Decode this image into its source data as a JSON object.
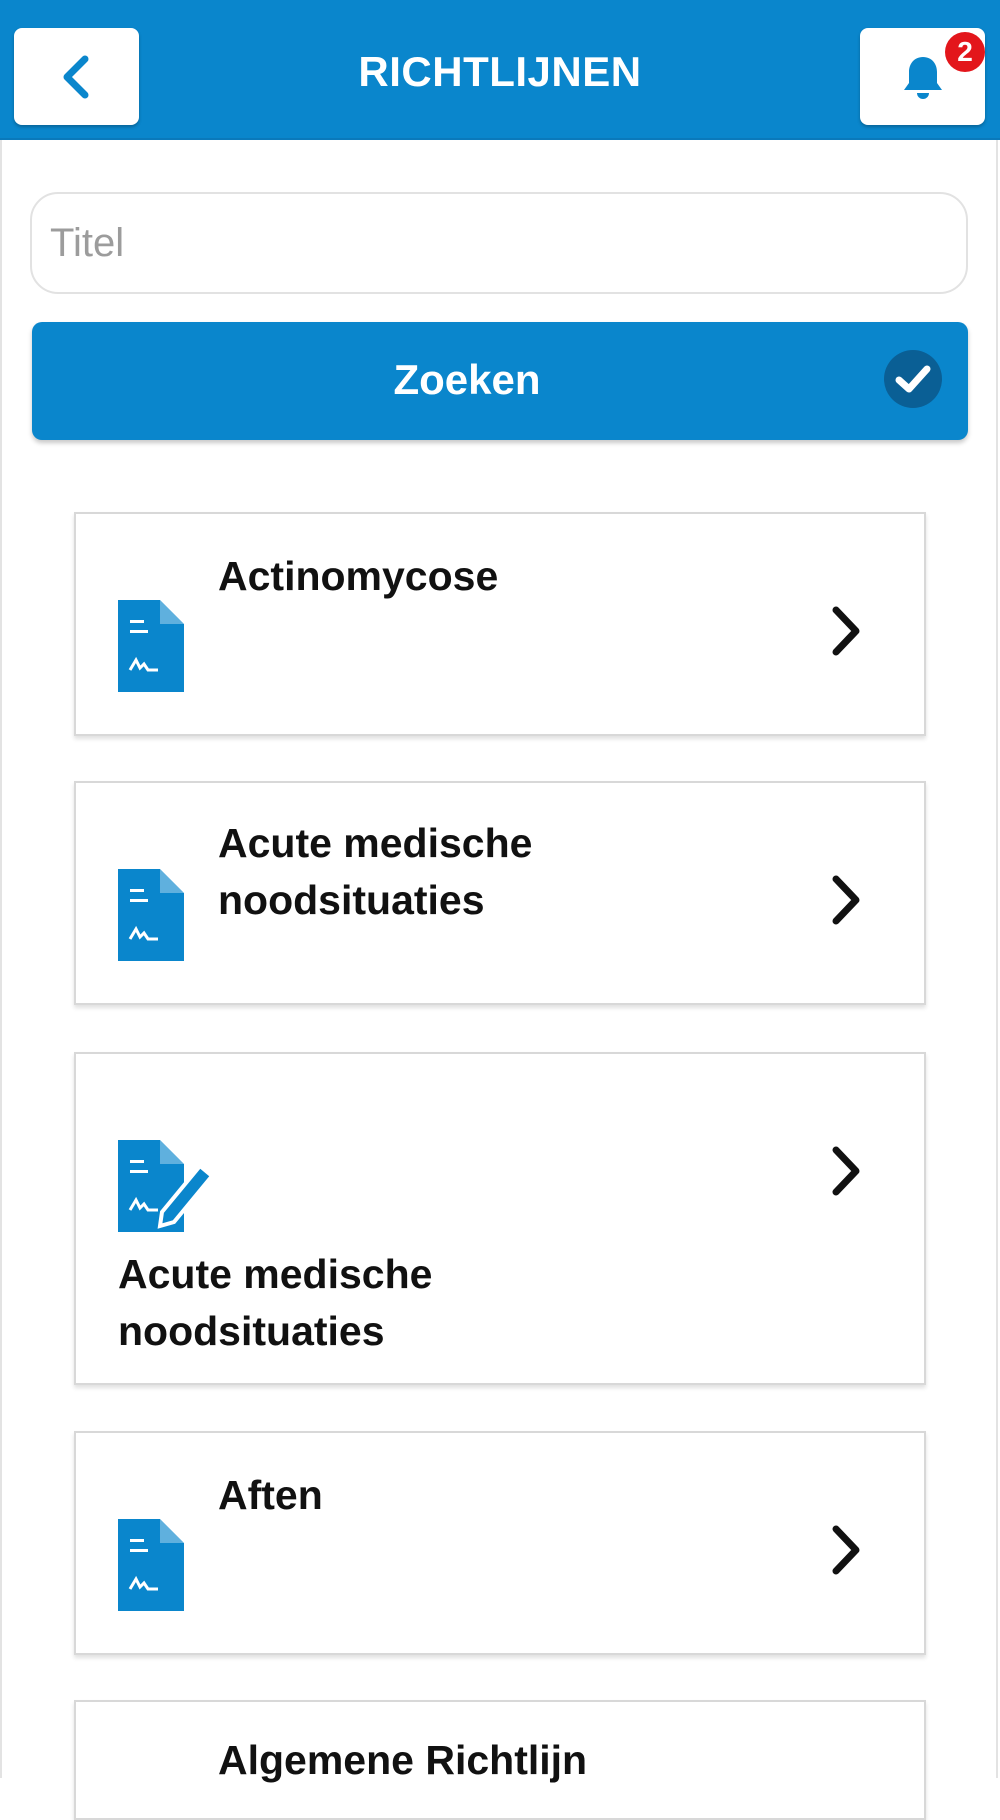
{
  "header": {
    "title": "RICHTLIJNEN",
    "notification_count": "2"
  },
  "search": {
    "placeholder": "Titel",
    "value": ""
  },
  "search_button": {
    "label": "Zoeken"
  },
  "items": [
    {
      "title": "Actinomycose",
      "icon": "document-icon"
    },
    {
      "title": "Acute medische\nnoodsituaties",
      "icon": "document-icon"
    },
    {
      "title": "Acute medische\nnoodsituaties",
      "icon": "document-edit-icon"
    },
    {
      "title": "Aften",
      "icon": "document-icon"
    },
    {
      "title": "Algemene Richtlijn",
      "icon": "document-icon"
    }
  ],
  "colors": {
    "brand_blue": "#0a86cc",
    "badge_red": "#e3161b"
  }
}
